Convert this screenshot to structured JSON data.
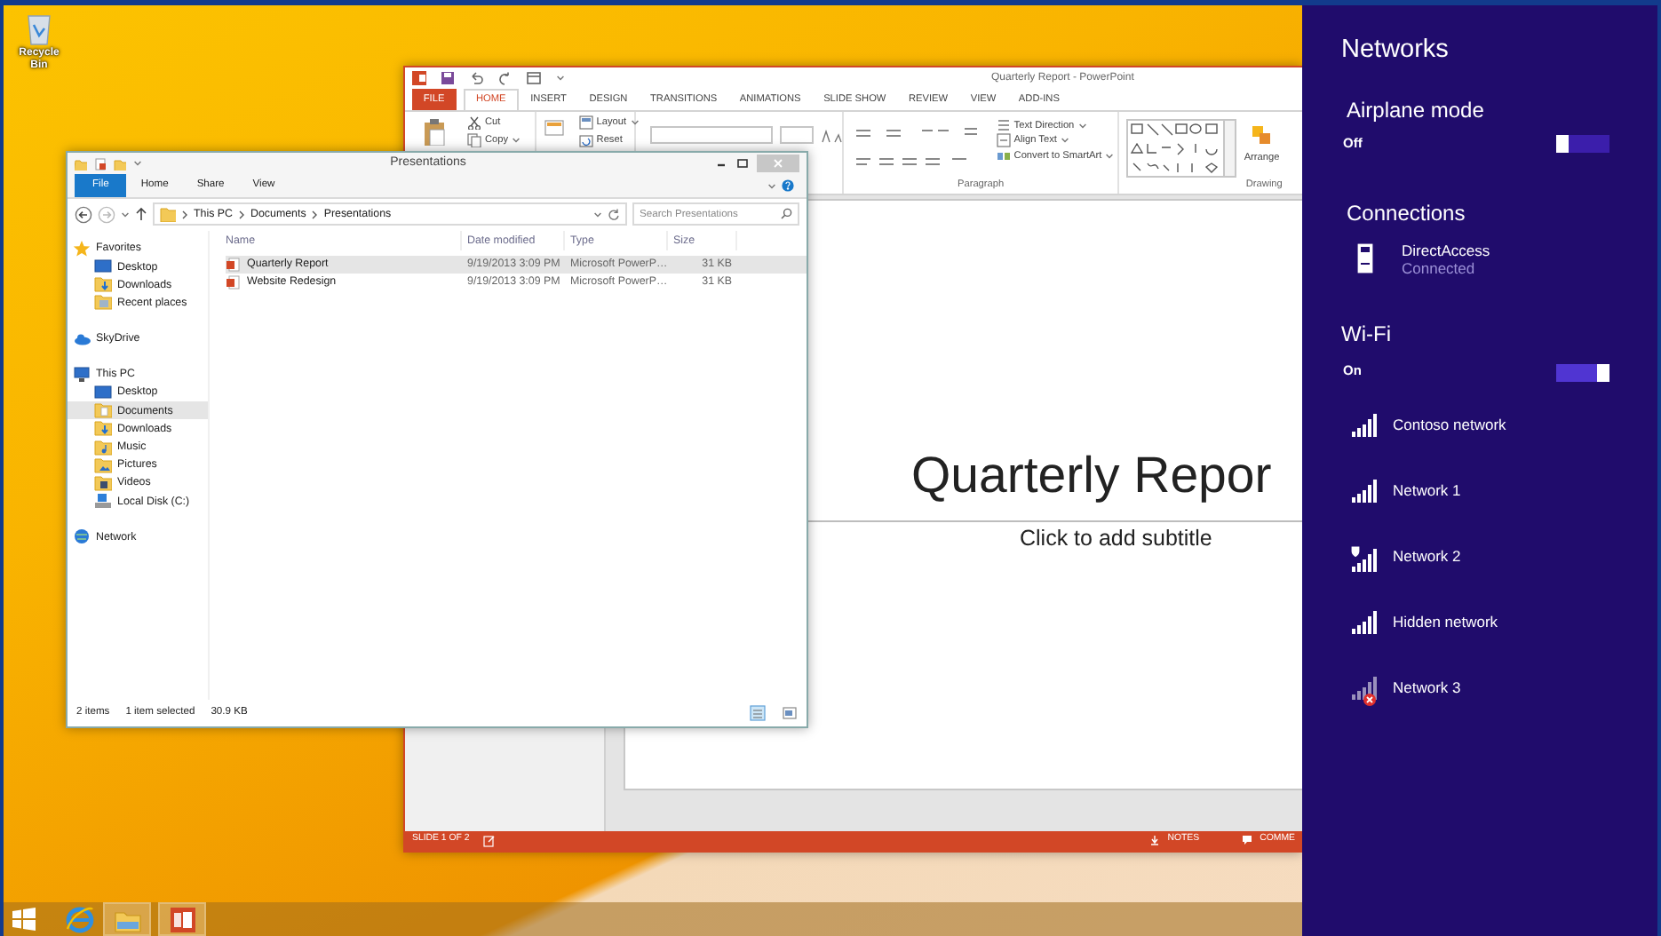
{
  "desktop": {
    "icons": [
      {
        "label": "Recycle Bin",
        "kind": "recycle"
      }
    ]
  },
  "powerpoint": {
    "title": "Quarterly Report - PowerPoint",
    "tabs": [
      {
        "label": "FILE",
        "kind": "file",
        "selected": false
      },
      {
        "label": "HOME",
        "kind": "tab",
        "selected": true
      },
      {
        "label": "INSERT",
        "kind": "tab",
        "selected": false
      },
      {
        "label": "DESIGN",
        "kind": "tab",
        "selected": false
      },
      {
        "label": "TRANSITIONS",
        "kind": "tab",
        "selected": false
      },
      {
        "label": "ANIMATIONS",
        "kind": "tab",
        "selected": false
      },
      {
        "label": "SLIDE SHOW",
        "kind": "tab",
        "selected": false
      },
      {
        "label": "REVIEW",
        "kind": "tab",
        "selected": false
      },
      {
        "label": "VIEW",
        "kind": "tab",
        "selected": false
      },
      {
        "label": "ADD-INS",
        "kind": "tab",
        "selected": false
      }
    ],
    "ribbon": {
      "clipboard": [
        {
          "label": "Cut",
          "kind": "cut",
          "dropdown": false
        },
        {
          "label": "Copy",
          "kind": "copy",
          "dropdown": true
        }
      ],
      "slides": [
        {
          "label": "Layout",
          "kind": "layout",
          "dropdown": true
        },
        {
          "label": "Reset",
          "kind": "reset",
          "dropdown": false
        }
      ],
      "paragraph": [
        {
          "label": "Text Direction",
          "kind": "direction",
          "dropdown": true
        },
        {
          "label": "Align Text",
          "kind": "align",
          "dropdown": true
        },
        {
          "label": "Convert to SmartArt",
          "kind": "smartart",
          "dropdown": true
        }
      ],
      "arrange": "Arrange",
      "group_labels": [
        "Paragraph",
        "Drawing"
      ]
    },
    "slide": {
      "title": "Quarterly Repor",
      "subtitle": "Click to add subtitle"
    },
    "status_bar": {
      "slide": "SLIDE 1 OF 2",
      "notes": "NOTES",
      "comments": "COMME"
    }
  },
  "explorer": {
    "title": "Presentations",
    "tabs": [
      {
        "label": "File",
        "kind": "file",
        "selected": false
      },
      {
        "label": "Home",
        "kind": "tab",
        "selected": false
      },
      {
        "label": "Share",
        "kind": "tab",
        "selected": false
      },
      {
        "label": "View",
        "kind": "tab",
        "selected": false
      }
    ],
    "path": [
      "This PC",
      "Documents",
      "Presentations"
    ],
    "search": {
      "placeholder": "Search Presentations"
    },
    "nav": [
      {
        "label": "Favorites",
        "kind": "star",
        "selected": false,
        "children": [
          {
            "label": "Desktop",
            "kind": "desktop",
            "selected": false
          },
          {
            "label": "Downloads",
            "kind": "downloads",
            "selected": false
          },
          {
            "label": "Recent places",
            "kind": "recent",
            "selected": false
          }
        ]
      },
      {
        "label": "SkyDrive",
        "kind": "cloud",
        "selected": false
      },
      {
        "label": "This PC",
        "kind": "pc",
        "selected": false,
        "children": [
          {
            "label": "Desktop",
            "kind": "desktop",
            "selected": false
          },
          {
            "label": "Documents",
            "kind": "documents",
            "selected": true
          },
          {
            "label": "Downloads",
            "kind": "downloads",
            "selected": false
          },
          {
            "label": "Music",
            "kind": "music",
            "selected": false
          },
          {
            "label": "Pictures",
            "kind": "pictures",
            "selected": false
          },
          {
            "label": "Videos",
            "kind": "videos",
            "selected": false
          },
          {
            "label": "Local Disk (C:)",
            "kind": "disk",
            "selected": false
          }
        ]
      },
      {
        "label": "Network",
        "kind": "network",
        "selected": false
      }
    ],
    "columns": [
      "Name",
      "Date modified",
      "Type",
      "Size"
    ],
    "rows": [
      {
        "name": "Quarterly Report",
        "date": "9/19/2013 3:09 PM",
        "type": "Microsoft PowerP…",
        "size": "31 KB",
        "selected": true
      },
      {
        "name": "Website Redesign",
        "date": "9/19/2013 3:09 PM",
        "type": "Microsoft PowerP…",
        "size": "31 KB",
        "selected": false
      }
    ],
    "status": {
      "count": "2 items",
      "selection": "1 item selected",
      "size": "30.9 KB"
    }
  },
  "taskbar": {
    "items": [
      {
        "kind": "start",
        "running": false
      },
      {
        "kind": "browser",
        "running": false
      },
      {
        "kind": "explorer",
        "running": true
      },
      {
        "kind": "powerpoint",
        "running": true
      }
    ]
  },
  "networks_panel": {
    "title": "Networks",
    "airplane": {
      "heading": "Airplane mode",
      "state": "Off",
      "on": false
    },
    "connections": {
      "heading": "Connections",
      "items": [
        {
          "name": "DirectAccess",
          "status": "Connected"
        }
      ]
    },
    "wifi": {
      "heading": "Wi-Fi",
      "state": "On",
      "on": true,
      "networks": [
        {
          "name": "Contoso network",
          "kind": "open"
        },
        {
          "name": "Network 1",
          "kind": "open"
        },
        {
          "name": "Network 2",
          "kind": "shield"
        },
        {
          "name": "Hidden network",
          "kind": "open"
        },
        {
          "name": "Network 3",
          "kind": "unavailable"
        }
      ]
    }
  }
}
